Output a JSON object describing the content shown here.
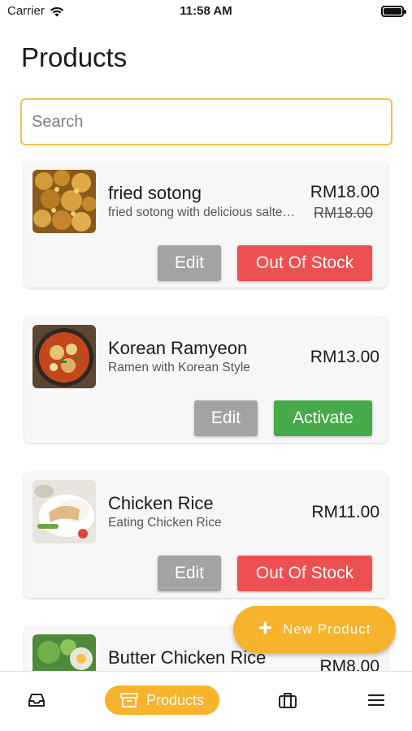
{
  "status_bar": {
    "carrier": "Carrier",
    "time": "11:58 AM"
  },
  "page": {
    "title": "Products"
  },
  "search": {
    "placeholder": "Search"
  },
  "products": [
    {
      "name": "fried sotong",
      "description": "fried sotong with delicious salted egg",
      "price": "RM18.00",
      "original_price": "RM18.00",
      "edit_label": "Edit",
      "action_label": "Out Of Stock",
      "action_color": "#ec5050"
    },
    {
      "name": "Korean Ramyeon",
      "description": "Ramen with Korean Style",
      "price": "RM13.00",
      "edit_label": "Edit",
      "action_label": "Activate",
      "action_color": "#46a94a"
    },
    {
      "name": "Chicken Rice",
      "description": "Eating Chicken Rice",
      "price": "RM11.00",
      "edit_label": "Edit",
      "action_label": "Out Of Stock",
      "action_color": "#ec5050"
    },
    {
      "name": "Butter Chicken Rice",
      "price": "RM8.00"
    }
  ],
  "fab": {
    "label": "New Product",
    "icon": "plus-icon"
  },
  "tab_bar": {
    "items": [
      {
        "icon": "inbox-icon"
      },
      {
        "icon": "archive-box-icon",
        "label": "Products",
        "active": true
      },
      {
        "icon": "briefcase-icon"
      },
      {
        "icon": "menu-icon"
      }
    ]
  },
  "colors": {
    "accent": "#f6b32b",
    "search_border": "#f2c244",
    "danger": "#ec5050",
    "success": "#46a94a",
    "neutral": "#a3a3a3"
  }
}
